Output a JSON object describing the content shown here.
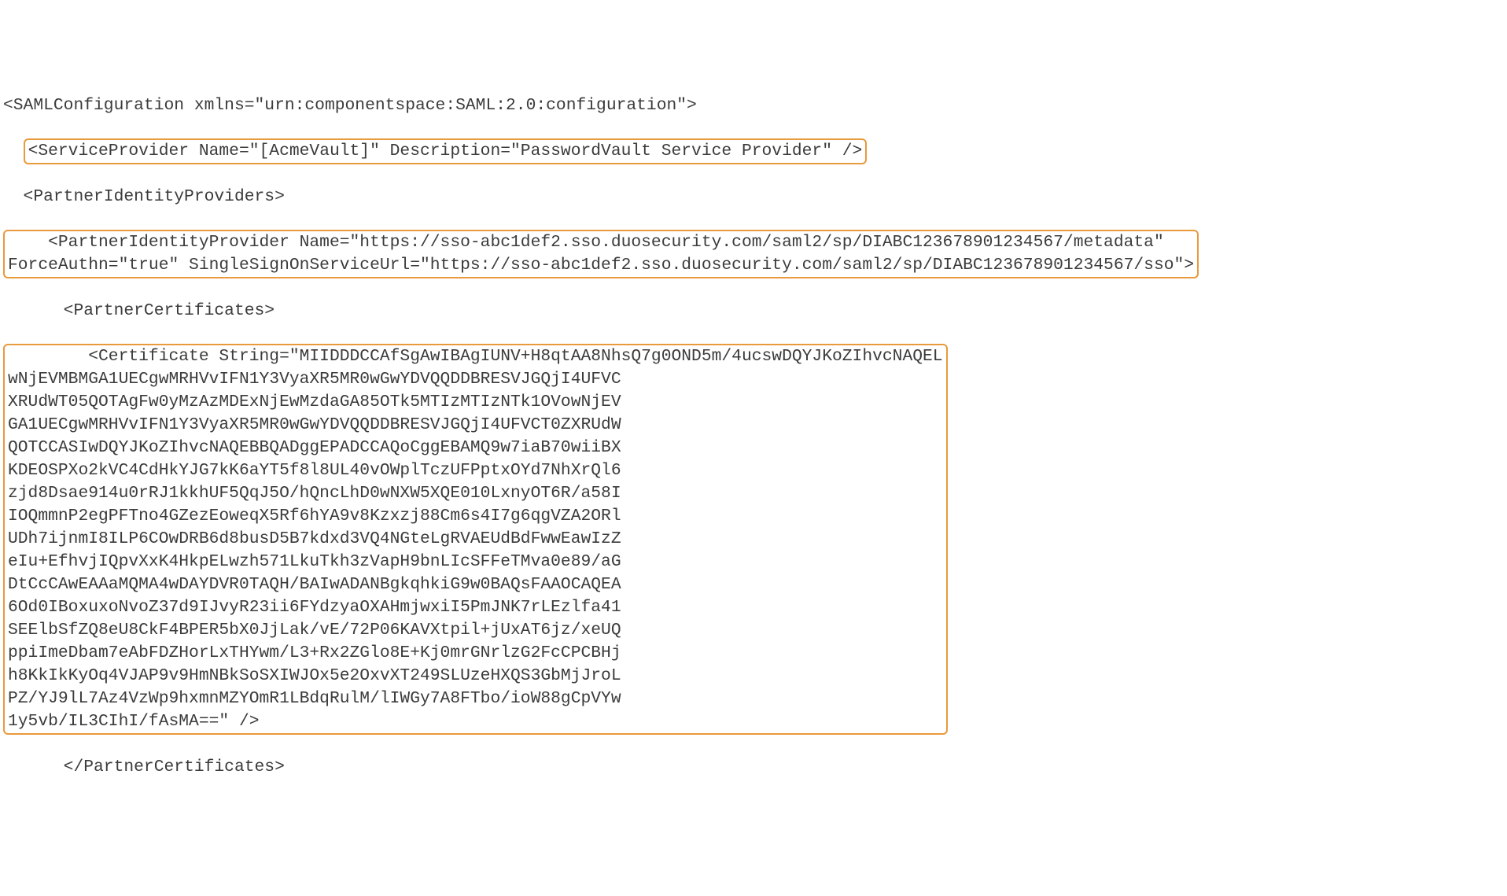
{
  "xml": {
    "line1": "<SAMLConfiguration xmlns=\"urn:componentspace:SAML:2.0:configuration\">",
    "line2_prefix": "  ",
    "line2_hl": "<ServiceProvider Name=\"[AcmeVault]\" Description=\"PasswordVault Service Provider\" />",
    "line3": "  <PartnerIdentityProviders>",
    "line4_hl1": "    <PartnerIdentityProvider Name=\"https://sso-abc1def2.sso.duosecurity.com/saml2/sp/DIABC123678901234567/metadata\"",
    "line4_hl2": "ForceAuthn=\"true\" SingleSignOnServiceUrl=\"https://sso-abc1def2.sso.duosecurity.com/saml2/sp/DIABC123678901234567/sso\">",
    "line5": "      <PartnerCertificates>",
    "cert_lines": [
      "        <Certificate String=\"MIIDDDCCAfSgAwIBAgIUNV+H8qtAA8NhsQ7g0OND5m/4ucswDQYJKoZIhvcNAQEL",
      "wNjEVMBMGA1UECgwMRHVvIFN1Y3VyaXR5MR0wGwYDVQQDDBRESVJGQjI4UFVC",
      "XRUdWT05QOTAgFw0yMzAzMDExNjEwMzdaGA85OTk5MTIzMTIzNTk1OVowNjEV",
      "GA1UECgwMRHVvIFN1Y3VyaXR5MR0wGwYDVQQDDBRESVJGQjI4UFVCT0ZXRUdW",
      "QOTCCASIwDQYJKoZIhvcNAQEBBQADggEPADCCAQoCggEBAMQ9w7iaB70wiiBX",
      "KDEOSPXo2kVC4CdHkYJG7kK6aYT5f8l8UL40vOWplTczUFPptxOYd7NhXrQl6",
      "zjd8Dsae914u0rRJ1kkhUF5QqJ5O/hQncLhD0wNXW5XQE010LxnyOT6R/a58I",
      "IOQmmnP2egPFTno4GZezEoweqX5Rf6hYA9v8Kzxzj88Cm6s4I7g6qgVZA2ORl",
      "UDh7ijnmI8ILP6COwDRB6d8busD5B7kdxd3VQ4NGteLgRVAEUdBdFwwEawIzZ",
      "eIu+EfhvjIQpvXxK4HkpELwzh571LkuTkh3zVapH9bnLIcSFFeTMva0e89/aG",
      "DtCcCAwEAAaMQMA4wDAYDVR0TAQH/BAIwADANBgkqhkiG9w0BAQsFAAOCAQEA",
      "6Od0IBoxuxoNvoZ37d9IJvyR23ii6FYdzyaOXAHmjwxiI5PmJNK7rLEzlfa41",
      "SEElbSfZQ8eU8CkF4BPER5bX0JjLak/vE/72P06KAVXtpil+jUxAT6jz/xeUQ",
      "ppiImeDbam7eAbFDZHorLxTHYwm/L3+Rx2ZGlo8E+Kj0mrGNrlzG2FcCPCBHj",
      "h8KkIkKyOq4VJAP9v9HmNBkSoSXIWJOx5e2OxvXT249SLUzeHXQS3GbMjJroL",
      "PZ/YJ9lL7Az4VzWp9hxmnMZYOmR1LBdqRulM/lIWGy7A8FTbo/ioW88gCpVYw",
      "1y5vb/IL3CIhI/fAsMA==\" />"
    ],
    "line_end": "      </PartnerCertificates>"
  }
}
